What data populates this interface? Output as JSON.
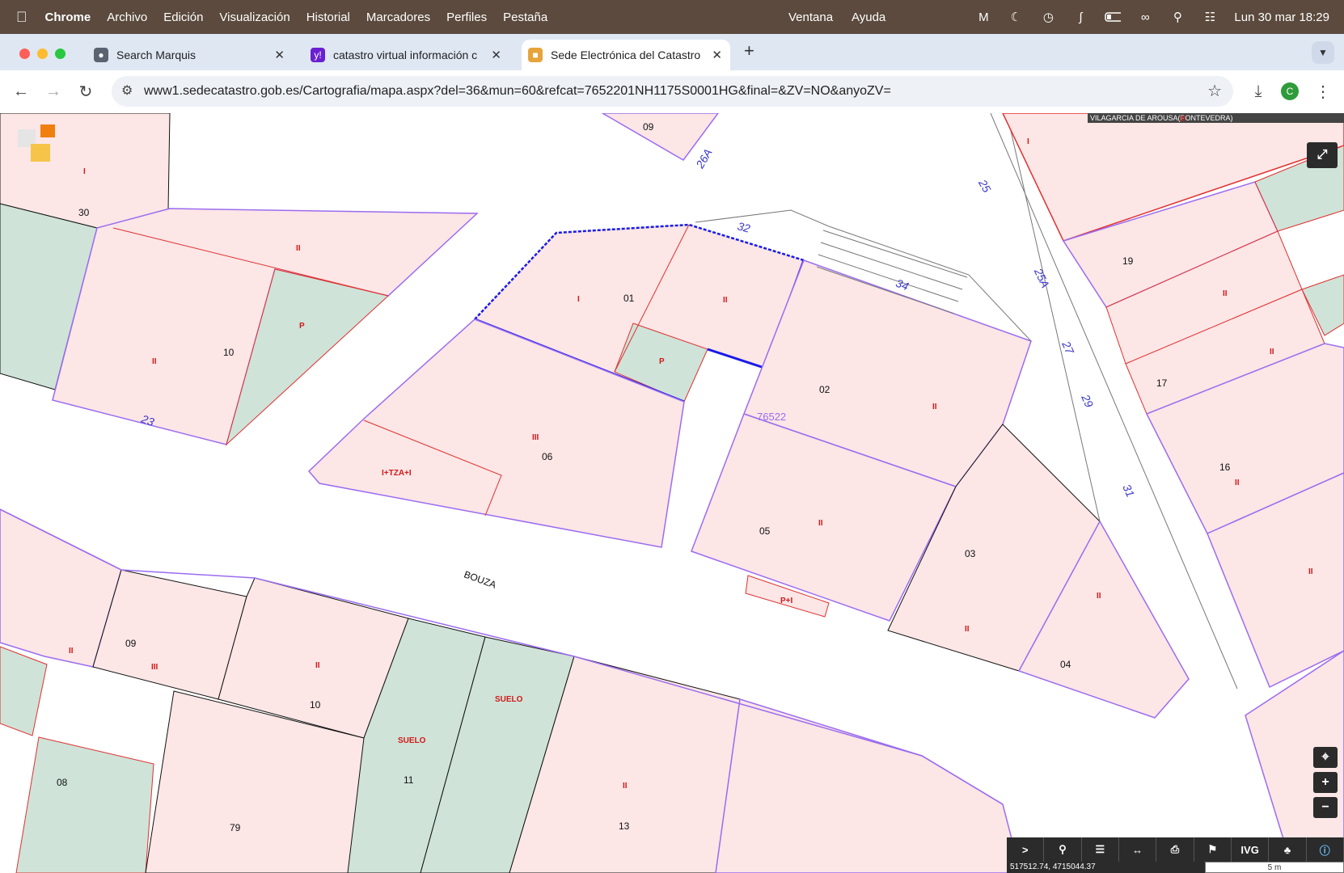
{
  "menubar": {
    "app": "Chrome",
    "items": [
      "Archivo",
      "Edición",
      "Visualización",
      "Historial",
      "Marcadores",
      "Perfiles",
      "Pestaña"
    ],
    "right_items": [
      "Ventana",
      "Ayuda"
    ],
    "clock": "Lun 30 mar 18:29"
  },
  "tabs": [
    {
      "title": "Search Marquis",
      "active": false
    },
    {
      "title": "catastro virtual información c",
      "active": false
    },
    {
      "title": "Sede Electrónica del Catastro",
      "active": true
    }
  ],
  "toolbar": {
    "url": "www1.sedecatastro.gob.es/Cartografia/mapa.aspx?del=36&mun=60&refcat=7652201NH1175S0001HG&final=&ZV=NO&anyoZV=",
    "profile_initial": "C"
  },
  "map": {
    "municipality": "VILAGARCIA DE AROUSA(PONTEVEDRA)",
    "block_ref": "76522",
    "street_name": "BOUZA",
    "coords": "517512.74, 4715044.37",
    "scale": "5 m",
    "parcel_numbers": [
      "09",
      "30",
      "10",
      "01",
      "02",
      "05",
      "06",
      "03",
      "04",
      "19",
      "17",
      "16",
      "09",
      "10",
      "11",
      "08",
      "79",
      "13"
    ],
    "floor_labels": [
      "I",
      "II",
      "P",
      "II",
      "I",
      "II",
      "P",
      "III",
      "I+TZA+I",
      "II",
      "II",
      "II",
      "II",
      "II",
      "II",
      "II",
      "III",
      "II",
      "SUELO",
      "SUELO",
      "II",
      "P+I",
      "I",
      "II",
      "II",
      "II",
      "II"
    ],
    "street_numbers": [
      "26A",
      "25",
      "32",
      "34",
      "25A",
      "27",
      "29",
      "31",
      "23"
    ]
  },
  "bottom_tools": [
    ">",
    "search",
    "layers",
    "measure",
    "print",
    "pin",
    "IVG",
    "group",
    "info"
  ],
  "colors": {
    "menubar": "#5b4a3d",
    "tabstrip": "#dfe7f3",
    "parcel_fill": "#fce6e6",
    "green_fill": "#cfe3d8",
    "purple_line": "#9b6cf0",
    "selected_line": "#1a1ae6",
    "red_line": "#e03030"
  }
}
